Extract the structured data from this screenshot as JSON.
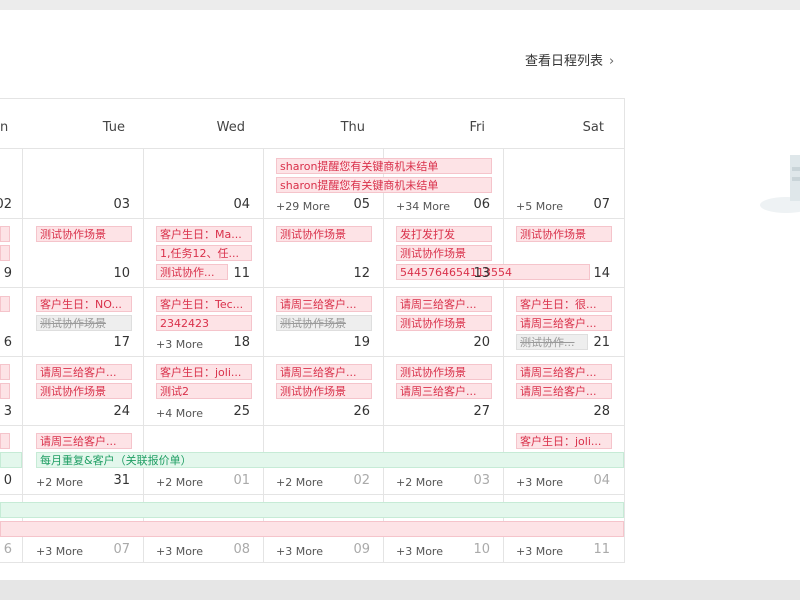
{
  "header": {
    "schedule_list_link": "查看日程列表",
    "chevron": "›"
  },
  "weekdays": [
    "n",
    "Tue",
    "Wed",
    "Thu",
    "Fri",
    "Sat"
  ],
  "weeks": [
    {
      "days": [
        "02",
        "03",
        "04",
        "05",
        "06",
        "07"
      ],
      "more": [
        "",
        "",
        "",
        "+29 More",
        "+34 More",
        "+5 More"
      ],
      "events": [
        {
          "text": "sharon提醒您有关键商机未结单",
          "style": "pink"
        },
        {
          "text": "sharon提醒您有关键商机未结单",
          "style": "pink"
        }
      ]
    },
    {
      "days": [
        "9",
        "10",
        "11",
        "12",
        "13",
        "14"
      ],
      "more": [
        "",
        "",
        "",
        "",
        "",
        ""
      ],
      "events": [
        {
          "text": "",
          "style": "pink"
        },
        {
          "text": "",
          "style": "pink"
        },
        {
          "text": "测试协作场景",
          "style": "pink"
        },
        {
          "text": "客户生日：Ma...",
          "style": "pink"
        },
        {
          "text": "1,任务12、任...",
          "style": "pink"
        },
        {
          "text": "测试协作...",
          "style": "pink"
        },
        {
          "text": "测试协作场景",
          "style": "pink"
        },
        {
          "text": "发打发打发",
          "style": "pink"
        },
        {
          "text": "测试协作场景",
          "style": "pink"
        },
        {
          "text": "5445764654113554",
          "style": "pink"
        },
        {
          "text": "测试协作场景",
          "style": "pink"
        }
      ]
    },
    {
      "days": [
        "6",
        "17",
        "18",
        "19",
        "20",
        "21"
      ],
      "more": [
        "",
        "",
        "+3 More",
        "",
        "",
        ""
      ],
      "events": [
        {
          "text": "",
          "style": "pink"
        },
        {
          "text": "客户生日：NO...",
          "style": "pink"
        },
        {
          "text": "测试协作场景",
          "style": "strike"
        },
        {
          "text": "客户生日：Tec...",
          "style": "pink"
        },
        {
          "text": "2342423",
          "style": "pink"
        },
        {
          "text": "请周三给客户...",
          "style": "pink"
        },
        {
          "text": "测试协作场景",
          "style": "strike"
        },
        {
          "text": "请周三给客户...",
          "style": "pink"
        },
        {
          "text": "测试协作场景",
          "style": "pink"
        },
        {
          "text": "客户生日：很...",
          "style": "pink"
        },
        {
          "text": "请周三给客户...",
          "style": "pink"
        },
        {
          "text": "测试协作...",
          "style": "strike"
        }
      ]
    },
    {
      "days": [
        "3",
        "24",
        "25",
        "26",
        "27",
        "28"
      ],
      "more": [
        "",
        "",
        "+4 More",
        "",
        "",
        ""
      ],
      "events": [
        {
          "text": "",
          "style": "pink"
        },
        {
          "text": "",
          "style": "pink"
        },
        {
          "text": "请周三给客户...",
          "style": "pink"
        },
        {
          "text": "测试协作场景",
          "style": "pink"
        },
        {
          "text": "客户生日：joli...",
          "style": "pink"
        },
        {
          "text": "测试2",
          "style": "pink"
        },
        {
          "text": "请周三给客户...",
          "style": "pink"
        },
        {
          "text": "测试协作场景",
          "style": "pink"
        },
        {
          "text": "测试协作场景",
          "style": "pink"
        },
        {
          "text": "请周三给客户...",
          "style": "pink"
        },
        {
          "text": "请周三给客户...",
          "style": "pink"
        },
        {
          "text": "请周三给客户...",
          "style": "pink"
        }
      ]
    },
    {
      "days": [
        "0",
        "31",
        "01",
        "02",
        "03",
        "04"
      ],
      "more": [
        "",
        "+2 More",
        "+2 More",
        "+2 More",
        "+2 More",
        "+3 More"
      ],
      "events": [
        {
          "text": "",
          "style": "pink"
        },
        {
          "text": "请周三给客户...",
          "style": "pink"
        },
        {
          "text": "客户生日：joli...",
          "style": "pink"
        },
        {
          "text": "每月重复&客户（关联报价单）",
          "style": "green"
        }
      ]
    },
    {
      "days": [
        "6",
        "07",
        "08",
        "09",
        "10",
        "11"
      ],
      "more": [
        "",
        "+3 More",
        "+3 More",
        "+3 More",
        "+3 More",
        "+3 More"
      ],
      "events": []
    }
  ]
}
